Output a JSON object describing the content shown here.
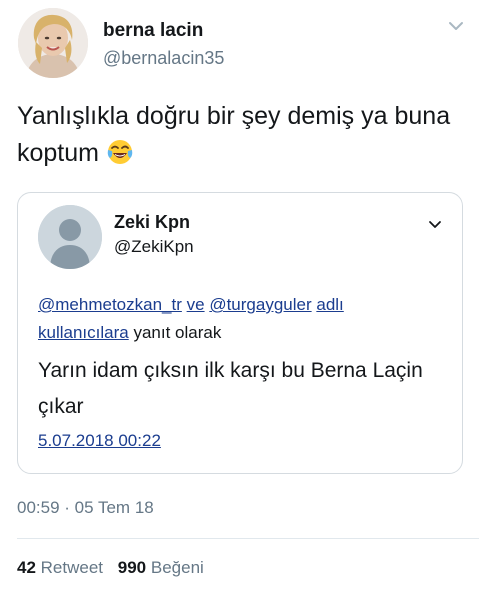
{
  "author": {
    "name": "berna lacin",
    "handle": "@bernalacin35"
  },
  "tweet": {
    "text": "Yanlışlıkla doğru bir şey demiş ya buna koptum",
    "emoji": "face-with-tears-of-joy"
  },
  "quoted_tweet": {
    "name": "Zeki Kpn",
    "handle": "@ZekiKpn",
    "reply_mention_1": "@mehmetozkan_tr",
    "reply_connector": "ve",
    "reply_mention_2": "@turgayguler",
    "reply_mention_3": "adlı kullanıcılara",
    "reply_suffix": "yanıt olarak",
    "text": "Yarın idam çıksın ilk karşı bu Berna Laçin çıkar",
    "date": "5.07.2018 00:22"
  },
  "meta": {
    "timestamp": "00:59 · 05 Tem 18"
  },
  "stats": {
    "retweets_count": "42",
    "retweets_label": "Retweet",
    "likes_count": "990",
    "likes_label": "Beğeni"
  },
  "colors": {
    "link": "#1b3d8f",
    "secondary_text": "#657786",
    "border": "#d5dbe0"
  }
}
